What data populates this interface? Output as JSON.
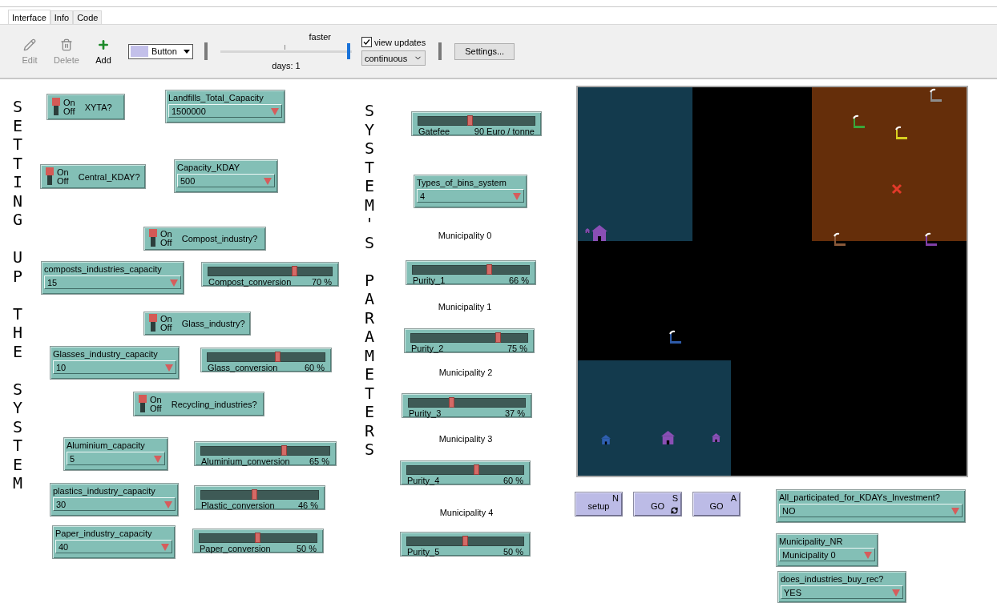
{
  "tabs": [
    {
      "label": "Interface",
      "selected": true
    },
    {
      "label": "Info",
      "selected": false
    },
    {
      "label": "Code",
      "selected": false
    }
  ],
  "toolbar": {
    "tools": [
      {
        "kind": "edit",
        "label": "Edit",
        "disabled": true
      },
      {
        "kind": "delete",
        "label": "Delete",
        "disabled": true
      },
      {
        "kind": "add",
        "label": "Add",
        "disabled": false
      }
    ],
    "widget_type": "Button",
    "speed_label": "faster",
    "speed": {
      "level": 0.99
    },
    "ticks": "days: 1",
    "view_updates": {
      "label": "view updates",
      "checked": true
    },
    "update_mode": "continuous",
    "settings": "Settings..."
  },
  "widgets": [
    {
      "kind": "vertical_note",
      "text": "SETTING UP THE SYSTEM"
    },
    {
      "kind": "switch",
      "label": "XYTA?",
      "on_text": "On",
      "off_text": "Off",
      "on": true
    },
    {
      "kind": "chooser",
      "label": "Landfills_Total_Capacity",
      "value": "1500000"
    },
    {
      "kind": "switch",
      "label": "Central_KDAY?",
      "on_text": "On",
      "off_text": "Off",
      "on": true
    },
    {
      "kind": "chooser",
      "label": "Capacity_KDAY",
      "value": "500"
    },
    {
      "kind": "switch",
      "label": "Compost_industry?",
      "on_text": "On",
      "off_text": "Off",
      "on": true
    },
    {
      "kind": "chooser",
      "label": "composts_industries_capacity",
      "value": "15"
    },
    {
      "kind": "slider",
      "label": "Compost_conversion",
      "reading": "70 %",
      "level": 0.7
    },
    {
      "kind": "switch",
      "label": "Glass_industry?",
      "on_text": "On",
      "off_text": "Off",
      "on": true
    },
    {
      "kind": "chooser",
      "label": "Glasses_industry_capacity",
      "value": "10"
    },
    {
      "kind": "slider",
      "label": "Glass_conversion",
      "reading": "60 %",
      "level": 0.6
    },
    {
      "kind": "switch",
      "label": "Recycling_industries?",
      "on_text": "On",
      "off_text": "Off",
      "on": true
    },
    {
      "kind": "chooser",
      "label": "Aluminium_capacity",
      "value": "5"
    },
    {
      "kind": "slider",
      "label": "Aluminium_conversion",
      "reading": "65 %",
      "level": 0.65
    },
    {
      "kind": "chooser",
      "label": "plastics_industry_capacity",
      "value": "30"
    },
    {
      "kind": "slider",
      "label": "Plastic_conversion",
      "reading": "46 %",
      "level": 0.46
    },
    {
      "kind": "chooser",
      "label": "Paper_industry_capacity",
      "value": "40"
    },
    {
      "kind": "slider",
      "label": "Paper_conversion",
      "reading": "50 %",
      "level": 0.5
    },
    {
      "kind": "vertical_note",
      "text": "SYSTEM'S PARAMETERS"
    },
    {
      "kind": "slider",
      "label": "Gatefee",
      "reading": "90 Euro / tonne",
      "level": 0.45
    },
    {
      "kind": "chooser",
      "label": "Types_of_bins_system",
      "value": "4"
    },
    {
      "kind": "note",
      "text": "Municipality 0"
    },
    {
      "kind": "slider",
      "label": "Purity_1",
      "reading": "66 %",
      "level": 0.66
    },
    {
      "kind": "note",
      "text": "Municipality 1"
    },
    {
      "kind": "slider",
      "label": "Purity_2",
      "reading": "75 %",
      "level": 0.75
    },
    {
      "kind": "note",
      "text": "Municipality 2"
    },
    {
      "kind": "slider",
      "label": "Purity_3",
      "reading": "37 %",
      "level": 0.37
    },
    {
      "kind": "note",
      "text": "Municipality 3"
    },
    {
      "kind": "slider",
      "label": "Purity_4",
      "reading": "60 %",
      "level": 0.6
    },
    {
      "kind": "note",
      "text": "Municipality 4"
    },
    {
      "kind": "slider",
      "label": "Purity_5",
      "reading": "50 %",
      "level": 0.5
    },
    {
      "kind": "button",
      "label": "setup",
      "key": "N",
      "forever": false
    },
    {
      "kind": "button",
      "label": "GO",
      "key": "S",
      "forever": true
    },
    {
      "kind": "button",
      "label": "GO",
      "key": "A",
      "forever": false
    },
    {
      "kind": "chooser",
      "label": "All_participated_for_KDAYs_Investment?",
      "value": "NO"
    },
    {
      "kind": "chooser",
      "label": "Municipality_NR",
      "value": "Municipality 0"
    },
    {
      "kind": "chooser",
      "label": "does_industries_buy_rec?",
      "value": "YES"
    }
  ]
}
